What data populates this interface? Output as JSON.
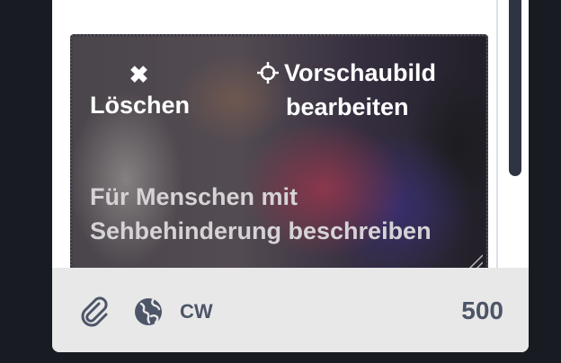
{
  "attachment": {
    "delete_label": "Löschen",
    "edit_label_1": "Vorschaubild",
    "edit_label_2": "bearbeiten",
    "describe_label_1": "Für Menschen mit",
    "describe_label_2": "Sehbehinderung beschreiben"
  },
  "footer": {
    "attach_icon": "paperclip-icon",
    "globe_icon": "globe-icon",
    "cw_label": "CW",
    "char_count": "500"
  },
  "colors": {
    "background": "#191b22",
    "footer_bg": "#e8e8e8",
    "footer_text": "#4d5568"
  }
}
